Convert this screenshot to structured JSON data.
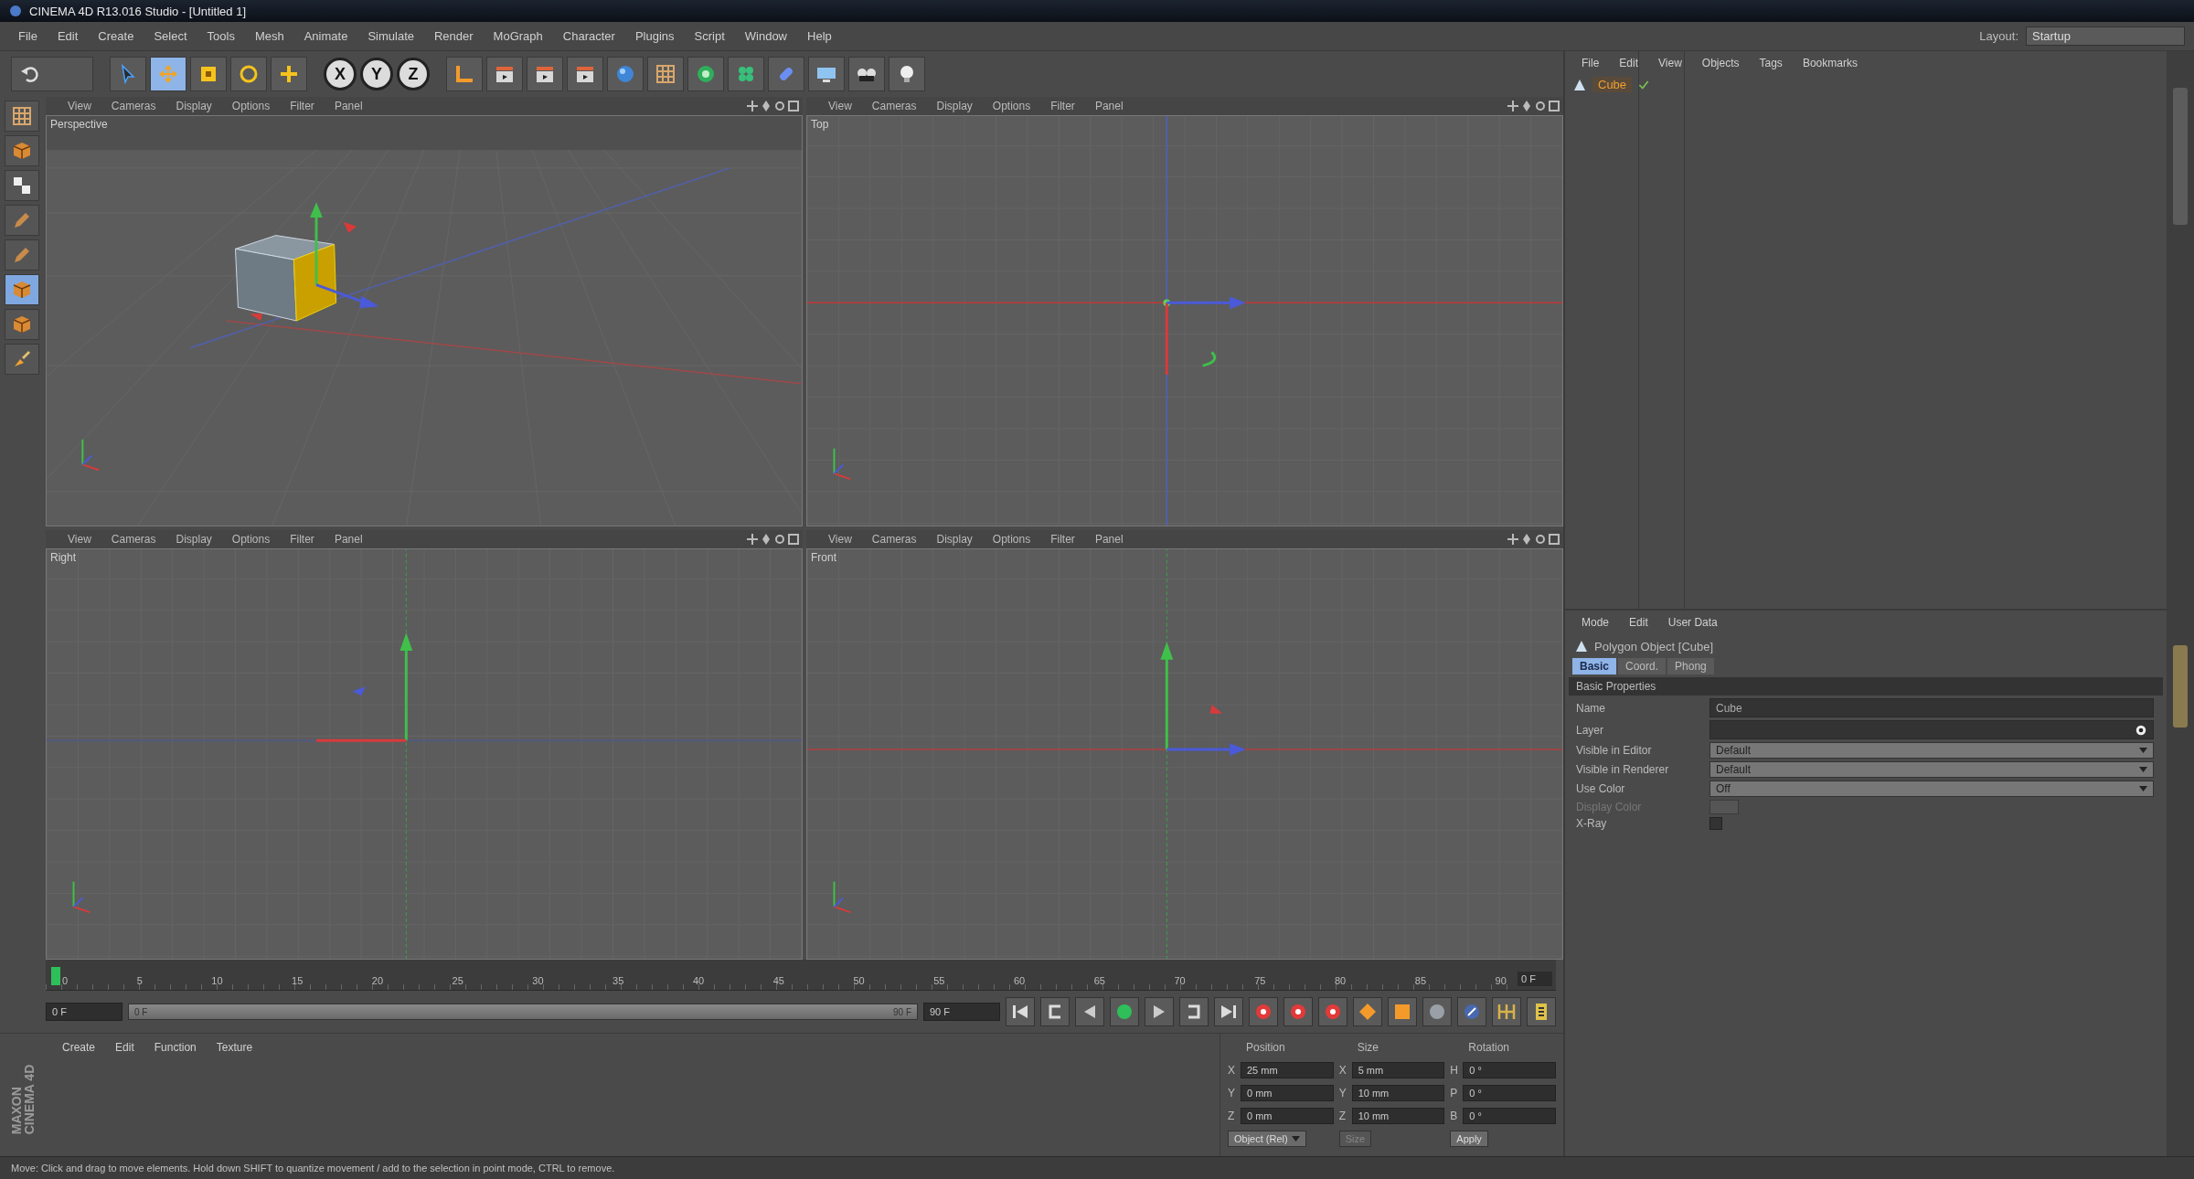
{
  "window": {
    "title": "CINEMA 4D R13.016 Studio - [Untitled 1]"
  },
  "menu_bar": [
    "File",
    "Edit",
    "Create",
    "Select",
    "Tools",
    "Mesh",
    "Animate",
    "Simulate",
    "Render",
    "MoGraph",
    "Character",
    "Plugins",
    "Script",
    "Window",
    "Help"
  ],
  "layout": {
    "label": "Layout:",
    "value": "Startup"
  },
  "toolbar": [
    {
      "kind": "undo"
    },
    {
      "kind": "tool",
      "selected": false
    },
    {
      "kind": "tool",
      "selected": true
    },
    {
      "kind": "tool",
      "selected": false
    },
    {
      "kind": "tool",
      "selected": false
    },
    {
      "kind": "tool",
      "selected": false
    },
    {
      "kind": "axis",
      "label": "X",
      "on": true
    },
    {
      "kind": "axis",
      "label": "Y",
      "on": true
    },
    {
      "kind": "axis",
      "label": "Z",
      "on": true
    },
    {
      "kind": "command"
    },
    {
      "kind": "command"
    },
    {
      "kind": "command"
    },
    {
      "kind": "command"
    },
    {
      "kind": "command"
    },
    {
      "kind": "command"
    },
    {
      "kind": "command"
    },
    {
      "kind": "command"
    },
    {
      "kind": "command"
    },
    {
      "kind": "command"
    },
    {
      "kind": "command"
    },
    {
      "kind": "command"
    }
  ],
  "left_tools": [
    {
      "selected": false
    },
    {
      "selected": false
    },
    {
      "selected": false
    },
    {
      "selected": false
    },
    {
      "selected": false
    },
    {
      "selected": true
    },
    {
      "selected": false
    },
    {
      "selected": false
    }
  ],
  "viewports": [
    {
      "kind": "perspective",
      "label": "Perspective",
      "menu": [
        "View",
        "Cameras",
        "Display",
        "Options",
        "Filter",
        "Panel"
      ]
    },
    {
      "kind": "top",
      "label": "Top",
      "menu": [
        "View",
        "Cameras",
        "Display",
        "Options",
        "Filter",
        "Panel"
      ]
    },
    {
      "kind": "right",
      "label": "Right",
      "menu": [
        "View",
        "Cameras",
        "Display",
        "Options",
        "Filter",
        "Panel"
      ]
    },
    {
      "kind": "front",
      "label": "Front",
      "menu": [
        "View",
        "Cameras",
        "Display",
        "Options",
        "Filter",
        "Panel"
      ]
    }
  ],
  "object_manager": {
    "menu": [
      "File",
      "Edit",
      "View",
      "Objects",
      "Tags",
      "Bookmarks"
    ],
    "objects": [
      {
        "name": "Cube",
        "selected": true
      }
    ]
  },
  "attribute_manager": {
    "menu": [
      "Mode",
      "Edit",
      "User Data"
    ],
    "title": "Polygon Object [Cube]",
    "tabs": [
      {
        "label": "Basic",
        "selected": true
      },
      {
        "label": "Coord.",
        "selected": false
      },
      {
        "label": "Phong",
        "selected": false
      }
    ],
    "section": "Basic Properties",
    "fields": [
      {
        "kind": "text",
        "label": "Name",
        "value": "Cube"
      },
      {
        "kind": "layer",
        "label": "Layer"
      },
      {
        "kind": "dropdown",
        "label": "Visible in Editor",
        "value": "Default"
      },
      {
        "kind": "dropdown",
        "label": "Visible in Renderer",
        "value": "Default"
      },
      {
        "kind": "dropdown",
        "label": "Use Color",
        "value": "Off"
      },
      {
        "kind": "color",
        "label": "Display Color",
        "disabled": true
      },
      {
        "kind": "checkbox",
        "label": "X-Ray",
        "checked": false
      }
    ]
  },
  "timeline": {
    "ticks": [
      "0",
      "5",
      "10",
      "15",
      "20",
      "25",
      "30",
      "35",
      "40",
      "45",
      "50",
      "55",
      "60",
      "65",
      "70",
      "75",
      "80",
      "85",
      "90"
    ],
    "current_frame": "0 F",
    "start": "0 F",
    "end": "90 F",
    "range_start": "0 F",
    "range_end": "90 F",
    "range_slider": {
      "level": 1
    }
  },
  "material_manager": {
    "menu": [
      "Create",
      "Edit",
      "Function",
      "Texture"
    ]
  },
  "brand": [
    "MAXON",
    "CINEMA 4D"
  ],
  "coordinates": {
    "headers": [
      "Position",
      "Size",
      "Rotation"
    ],
    "rows": [
      {
        "axis": "X",
        "position": "25 mm",
        "size_axis": "X",
        "size": "5 mm",
        "rot_axis": "H",
        "rotation": "0 °"
      },
      {
        "axis": "Y",
        "position": "0 mm",
        "size_axis": "Y",
        "size": "10 mm",
        "rot_axis": "P",
        "rotation": "0 °"
      },
      {
        "axis": "Z",
        "position": "0 mm",
        "size_axis": "Z",
        "size": "10 mm",
        "rot_axis": "B",
        "rotation": "0 °"
      }
    ],
    "mode": "Object (Rel)",
    "size_mode": "Size",
    "apply": "Apply"
  },
  "status_bar": "Move: Click and drag to move elements. Hold down SHIFT to quantize movement / add to the selection in point mode, CTRL to remove."
}
